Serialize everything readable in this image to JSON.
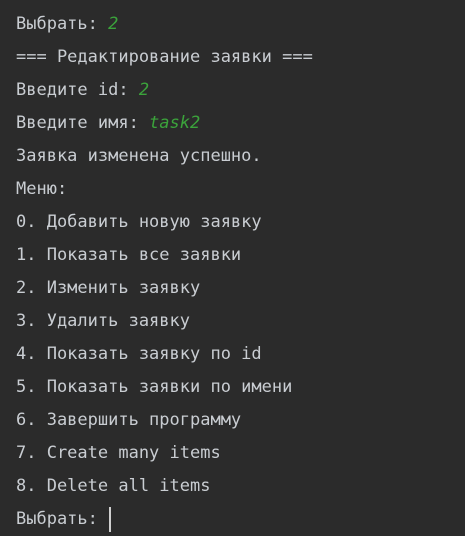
{
  "console": {
    "colors": {
      "background": "#2b2b2b",
      "text": "#c9cdd2",
      "user_input": "#3ba33b"
    },
    "lines": [
      {
        "prompt": "Выбрать: ",
        "input": "2"
      },
      {
        "text": "=== Редактирование заявки ==="
      },
      {
        "prompt": "Введите id: ",
        "input": "2"
      },
      {
        "prompt": "Введите имя: ",
        "input": "task2"
      },
      {
        "text": "Заявка изменена успешно."
      },
      {
        "text": "Меню:"
      },
      {
        "text": "0. Добавить новую заявку"
      },
      {
        "text": "1. Показать все заявки"
      },
      {
        "text": "2. Изменить заявку"
      },
      {
        "text": "3. Удалить заявку"
      },
      {
        "text": "4. Показать заявку по id"
      },
      {
        "text": "5. Показать заявки по имени"
      },
      {
        "text": "6. Завершить программу"
      },
      {
        "text": "7. Create many items"
      },
      {
        "text": "8. Delete all items"
      },
      {
        "prompt": "Выбрать: ",
        "input": ""
      }
    ]
  }
}
